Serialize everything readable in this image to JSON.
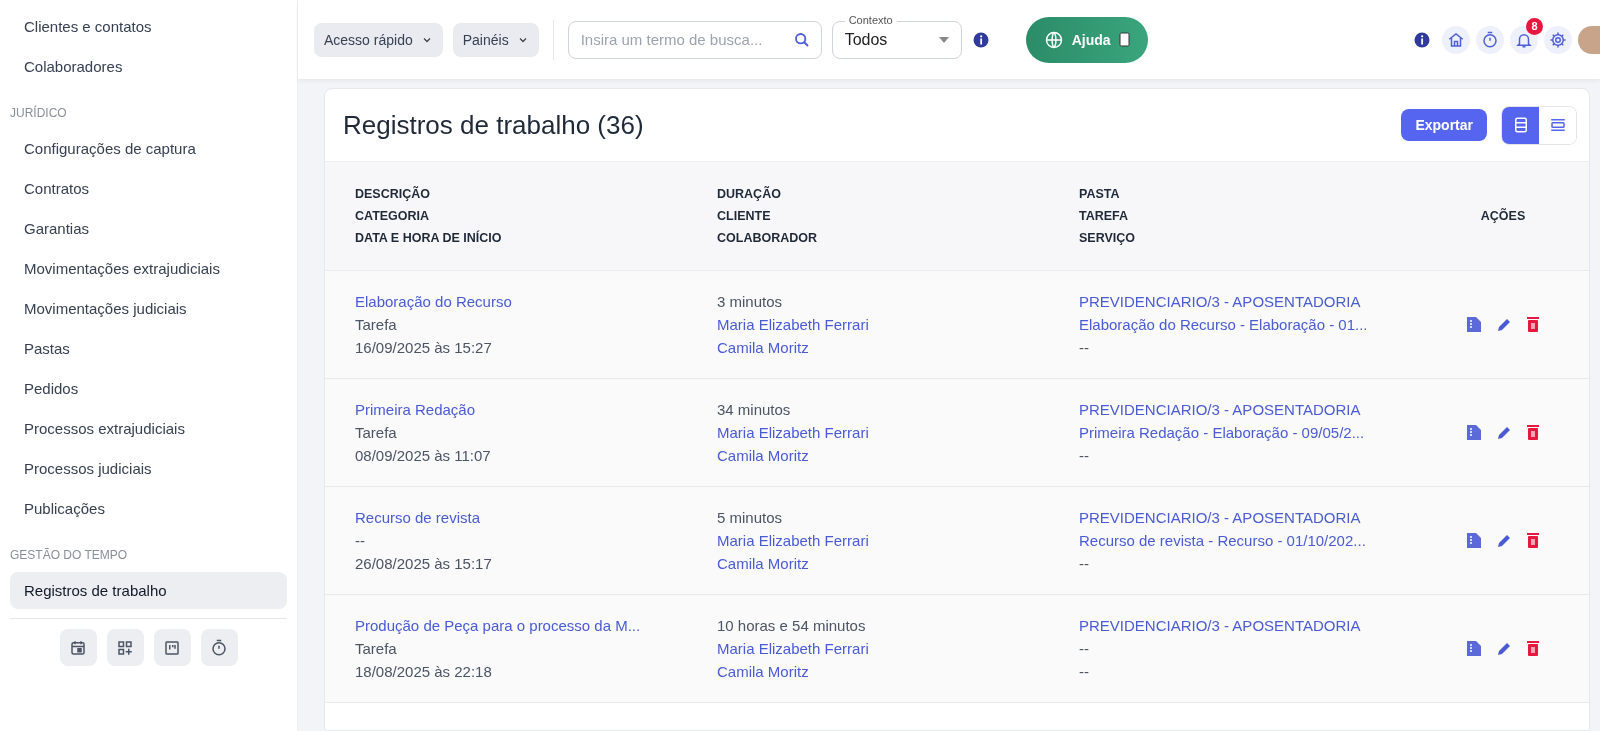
{
  "sidebar": {
    "sections": [
      {
        "items": [
          {
            "label": "Clientes e contatos",
            "selected": false
          },
          {
            "label": "Colaboradores",
            "selected": false
          }
        ]
      },
      {
        "heading": "JURÍDICO",
        "items": [
          {
            "label": "Configurações de captura",
            "selected": false
          },
          {
            "label": "Contratos",
            "selected": false
          },
          {
            "label": "Garantias",
            "selected": false
          },
          {
            "label": "Movimentações extrajudiciais",
            "selected": false
          },
          {
            "label": "Movimentações judiciais",
            "selected": false
          },
          {
            "label": "Pastas",
            "selected": false
          },
          {
            "label": "Pedidos",
            "selected": false
          },
          {
            "label": "Processos extrajudiciais",
            "selected": false
          },
          {
            "label": "Processos judiciais",
            "selected": false
          },
          {
            "label": "Publicações",
            "selected": false
          }
        ]
      },
      {
        "heading": "GESTÃO DO TEMPO",
        "items": [
          {
            "label": "Registros de trabalho",
            "selected": true
          }
        ]
      }
    ],
    "shortcuts": [
      {
        "kind": "calendar"
      },
      {
        "kind": "grid-add"
      },
      {
        "kind": "board"
      },
      {
        "kind": "timer"
      }
    ]
  },
  "topbar": {
    "menus": [
      "Acesso rápido",
      "Painéis"
    ],
    "search": {
      "placeholder": "Insira um termo de busca..."
    },
    "context": {
      "label": "Contexto",
      "value": "Todos"
    },
    "help": "Ajuda",
    "icons": [
      {
        "kind": "info"
      },
      {
        "kind": "home"
      },
      {
        "kind": "timer"
      },
      {
        "kind": "bell",
        "badge": "8"
      },
      {
        "kind": "settings"
      },
      {
        "kind": "avatar"
      }
    ]
  },
  "page": {
    "title": "Registros de trabalho (36)",
    "export": "Exportar",
    "views": [
      {
        "kind": "list",
        "selected": true
      },
      {
        "kind": "compact",
        "selected": false
      }
    ]
  },
  "table": {
    "header_groups": [
      [
        "DESCRIÇÃO",
        "CATEGORIA",
        "DATA E HORA DE INÍCIO"
      ],
      [
        "DURAÇÃO",
        "CLIENTE",
        "COLABORADOR"
      ],
      [
        "PASTA",
        "TAREFA",
        "SERVIÇO"
      ]
    ],
    "actions_header": "AÇÕES",
    "rows": [
      {
        "cells": [
          [
            {
              "text": "Elaboração do Recurso",
              "link": true
            },
            {
              "text": "Tarefa",
              "link": false
            },
            {
              "text": "16/09/2025 às 15:27",
              "link": false
            }
          ],
          [
            {
              "text": "3 minutos",
              "link": false
            },
            {
              "text": "Maria Elizabeth Ferrari",
              "link": true
            },
            {
              "text": "Camila Moritz",
              "link": true
            }
          ],
          [
            {
              "text": "PREVIDENCIARIO/3 - APOSENTADORIA",
              "link": true
            },
            {
              "text": "Elaboração do Recurso - Elaboração - 01...",
              "link": true
            },
            {
              "text": "--",
              "link": false
            }
          ]
        ]
      },
      {
        "cells": [
          [
            {
              "text": "Primeira Redação",
              "link": true
            },
            {
              "text": "Tarefa",
              "link": false
            },
            {
              "text": "08/09/2025 às 11:07",
              "link": false
            }
          ],
          [
            {
              "text": "34 minutos",
              "link": false
            },
            {
              "text": "Maria Elizabeth Ferrari",
              "link": true
            },
            {
              "text": "Camila Moritz",
              "link": true
            }
          ],
          [
            {
              "text": "PREVIDENCIARIO/3 - APOSENTADORIA",
              "link": true
            },
            {
              "text": "Primeira Redação - Elaboração - 09/05/2...",
              "link": true
            },
            {
              "text": "--",
              "link": false
            }
          ]
        ]
      },
      {
        "cells": [
          [
            {
              "text": "Recurso de revista",
              "link": true
            },
            {
              "text": "--",
              "link": false
            },
            {
              "text": "26/08/2025 às 15:17",
              "link": false
            }
          ],
          [
            {
              "text": "5 minutos",
              "link": false
            },
            {
              "text": "Maria Elizabeth Ferrari",
              "link": true
            },
            {
              "text": "Camila Moritz",
              "link": true
            }
          ],
          [
            {
              "text": "PREVIDENCIARIO/3 - APOSENTADORIA",
              "link": true
            },
            {
              "text": "Recurso de revista - Recurso - 01/10/202...",
              "link": true
            },
            {
              "text": "--",
              "link": false
            }
          ]
        ]
      },
      {
        "cells": [
          [
            {
              "text": "Produção de Peça para o processo da M...",
              "link": true
            },
            {
              "text": "Tarefa",
              "link": false
            },
            {
              "text": "18/08/2025 às 22:18",
              "link": false
            }
          ],
          [
            {
              "text": "10 horas e 54 minutos",
              "link": false
            },
            {
              "text": "Maria Elizabeth Ferrari",
              "link": true
            },
            {
              "text": "Camila Moritz",
              "link": true
            }
          ],
          [
            {
              "text": "PREVIDENCIARIO/3 - APOSENTADORIA",
              "link": true
            },
            {
              "text": "--",
              "link": false
            },
            {
              "text": "--",
              "link": false
            }
          ]
        ]
      }
    ]
  }
}
